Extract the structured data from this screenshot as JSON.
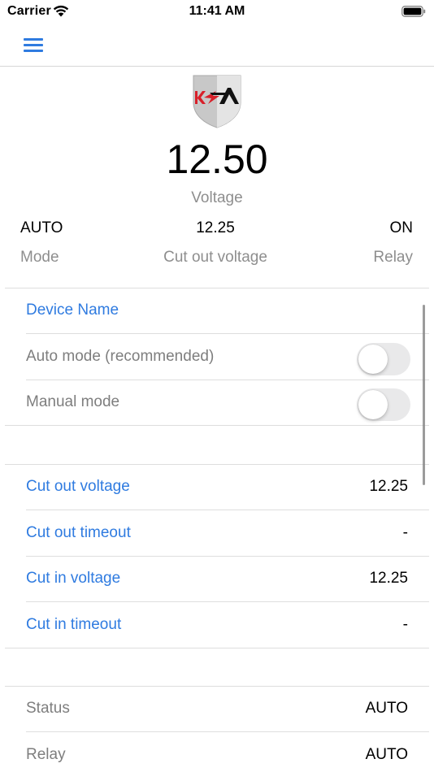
{
  "status_bar": {
    "carrier": "Carrier",
    "time": "11:41 AM"
  },
  "header": {
    "voltage_value": "12.50",
    "voltage_label": "Voltage",
    "mode_value": "AUTO",
    "mode_label": "Mode",
    "cutout_value": "12.25",
    "cutout_label": "Cut out voltage",
    "relay_value": "ON",
    "relay_label": "Relay"
  },
  "settings": {
    "device_name": "Device Name",
    "auto_mode": {
      "label": "Auto mode (recommended)",
      "on": false
    },
    "manual_mode": {
      "label": "Manual mode",
      "on": false
    }
  },
  "parameters": [
    {
      "label": "Cut out voltage",
      "value": "12.25"
    },
    {
      "label": "Cut out timeout",
      "value": "-"
    },
    {
      "label": "Cut in voltage",
      "value": "12.25"
    },
    {
      "label": "Cut in timeout",
      "value": "-"
    }
  ],
  "info": [
    {
      "label": "Status",
      "value": "AUTO"
    },
    {
      "label": "Relay",
      "value": "AUTO"
    }
  ],
  "colors": {
    "accent": "#2f7be0",
    "secondary_text": "#8e8e8e",
    "logo_red": "#d8202a"
  }
}
